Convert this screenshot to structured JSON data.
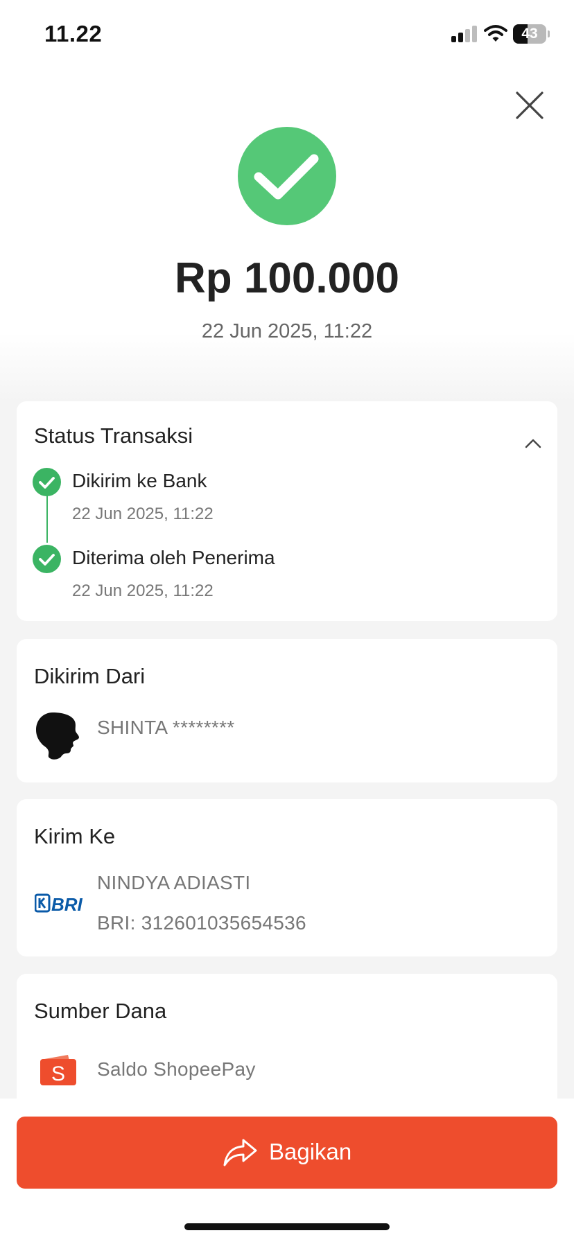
{
  "status_bar": {
    "time": "11.22",
    "battery_level": "43",
    "icons": [
      "signal-icon",
      "wifi-icon",
      "battery-icon"
    ]
  },
  "header": {
    "close_icon": "close-icon",
    "success_icon": "check-circle-icon",
    "amount": "Rp 100.000",
    "timestamp": "22 Jun 2025, 11:22"
  },
  "status_transaksi": {
    "title": "Status Transaksi",
    "steps": [
      {
        "label": "Dikirim ke Bank",
        "time": "22 Jun 2025, 11:22"
      },
      {
        "label": "Diterima oleh Penerima",
        "time": "22 Jun 2025, 11:22"
      }
    ]
  },
  "dikirim_dari": {
    "title": "Dikirim Dari",
    "name": "SHINTA ********"
  },
  "kirim_ke": {
    "title": "Kirim Ke",
    "logo_text": "BRI",
    "name": "NINDYA ADIASTI",
    "account": "BRI: 312601035654536"
  },
  "sumber_dana": {
    "title": "Sumber Dana",
    "source": "Saldo ShopeePay"
  },
  "footer": {
    "share_label": "Bagikan"
  },
  "colors": {
    "success": "#55c877",
    "timeline": "#3bb463",
    "brand": "#ee4d2d",
    "bri_blue": "#0a5aa8"
  }
}
